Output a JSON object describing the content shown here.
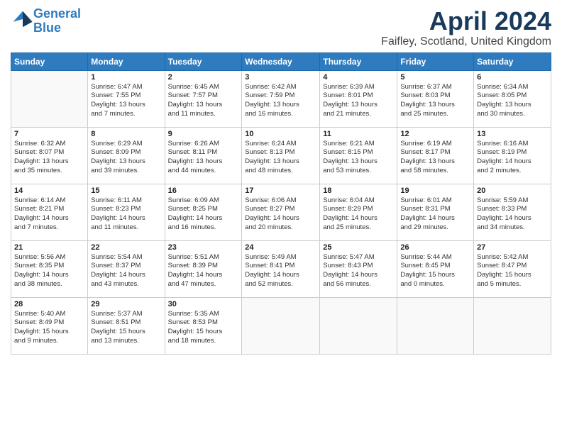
{
  "header": {
    "logo_line1": "General",
    "logo_line2": "Blue",
    "month_title": "April 2024",
    "subtitle": "Faifley, Scotland, United Kingdom"
  },
  "weekdays": [
    "Sunday",
    "Monday",
    "Tuesday",
    "Wednesday",
    "Thursday",
    "Friday",
    "Saturday"
  ],
  "weeks": [
    [
      {
        "day": "",
        "info": ""
      },
      {
        "day": "1",
        "info": "Sunrise: 6:47 AM\nSunset: 7:55 PM\nDaylight: 13 hours\nand 7 minutes."
      },
      {
        "day": "2",
        "info": "Sunrise: 6:45 AM\nSunset: 7:57 PM\nDaylight: 13 hours\nand 11 minutes."
      },
      {
        "day": "3",
        "info": "Sunrise: 6:42 AM\nSunset: 7:59 PM\nDaylight: 13 hours\nand 16 minutes."
      },
      {
        "day": "4",
        "info": "Sunrise: 6:39 AM\nSunset: 8:01 PM\nDaylight: 13 hours\nand 21 minutes."
      },
      {
        "day": "5",
        "info": "Sunrise: 6:37 AM\nSunset: 8:03 PM\nDaylight: 13 hours\nand 25 minutes."
      },
      {
        "day": "6",
        "info": "Sunrise: 6:34 AM\nSunset: 8:05 PM\nDaylight: 13 hours\nand 30 minutes."
      }
    ],
    [
      {
        "day": "7",
        "info": "Sunrise: 6:32 AM\nSunset: 8:07 PM\nDaylight: 13 hours\nand 35 minutes."
      },
      {
        "day": "8",
        "info": "Sunrise: 6:29 AM\nSunset: 8:09 PM\nDaylight: 13 hours\nand 39 minutes."
      },
      {
        "day": "9",
        "info": "Sunrise: 6:26 AM\nSunset: 8:11 PM\nDaylight: 13 hours\nand 44 minutes."
      },
      {
        "day": "10",
        "info": "Sunrise: 6:24 AM\nSunset: 8:13 PM\nDaylight: 13 hours\nand 48 minutes."
      },
      {
        "day": "11",
        "info": "Sunrise: 6:21 AM\nSunset: 8:15 PM\nDaylight: 13 hours\nand 53 minutes."
      },
      {
        "day": "12",
        "info": "Sunrise: 6:19 AM\nSunset: 8:17 PM\nDaylight: 13 hours\nand 58 minutes."
      },
      {
        "day": "13",
        "info": "Sunrise: 6:16 AM\nSunset: 8:19 PM\nDaylight: 14 hours\nand 2 minutes."
      }
    ],
    [
      {
        "day": "14",
        "info": "Sunrise: 6:14 AM\nSunset: 8:21 PM\nDaylight: 14 hours\nand 7 minutes."
      },
      {
        "day": "15",
        "info": "Sunrise: 6:11 AM\nSunset: 8:23 PM\nDaylight: 14 hours\nand 11 minutes."
      },
      {
        "day": "16",
        "info": "Sunrise: 6:09 AM\nSunset: 8:25 PM\nDaylight: 14 hours\nand 16 minutes."
      },
      {
        "day": "17",
        "info": "Sunrise: 6:06 AM\nSunset: 8:27 PM\nDaylight: 14 hours\nand 20 minutes."
      },
      {
        "day": "18",
        "info": "Sunrise: 6:04 AM\nSunset: 8:29 PM\nDaylight: 14 hours\nand 25 minutes."
      },
      {
        "day": "19",
        "info": "Sunrise: 6:01 AM\nSunset: 8:31 PM\nDaylight: 14 hours\nand 29 minutes."
      },
      {
        "day": "20",
        "info": "Sunrise: 5:59 AM\nSunset: 8:33 PM\nDaylight: 14 hours\nand 34 minutes."
      }
    ],
    [
      {
        "day": "21",
        "info": "Sunrise: 5:56 AM\nSunset: 8:35 PM\nDaylight: 14 hours\nand 38 minutes."
      },
      {
        "day": "22",
        "info": "Sunrise: 5:54 AM\nSunset: 8:37 PM\nDaylight: 14 hours\nand 43 minutes."
      },
      {
        "day": "23",
        "info": "Sunrise: 5:51 AM\nSunset: 8:39 PM\nDaylight: 14 hours\nand 47 minutes."
      },
      {
        "day": "24",
        "info": "Sunrise: 5:49 AM\nSunset: 8:41 PM\nDaylight: 14 hours\nand 52 minutes."
      },
      {
        "day": "25",
        "info": "Sunrise: 5:47 AM\nSunset: 8:43 PM\nDaylight: 14 hours\nand 56 minutes."
      },
      {
        "day": "26",
        "info": "Sunrise: 5:44 AM\nSunset: 8:45 PM\nDaylight: 15 hours\nand 0 minutes."
      },
      {
        "day": "27",
        "info": "Sunrise: 5:42 AM\nSunset: 8:47 PM\nDaylight: 15 hours\nand 5 minutes."
      }
    ],
    [
      {
        "day": "28",
        "info": "Sunrise: 5:40 AM\nSunset: 8:49 PM\nDaylight: 15 hours\nand 9 minutes."
      },
      {
        "day": "29",
        "info": "Sunrise: 5:37 AM\nSunset: 8:51 PM\nDaylight: 15 hours\nand 13 minutes."
      },
      {
        "day": "30",
        "info": "Sunrise: 5:35 AM\nSunset: 8:53 PM\nDaylight: 15 hours\nand 18 minutes."
      },
      {
        "day": "",
        "info": ""
      },
      {
        "day": "",
        "info": ""
      },
      {
        "day": "",
        "info": ""
      },
      {
        "day": "",
        "info": ""
      }
    ]
  ]
}
